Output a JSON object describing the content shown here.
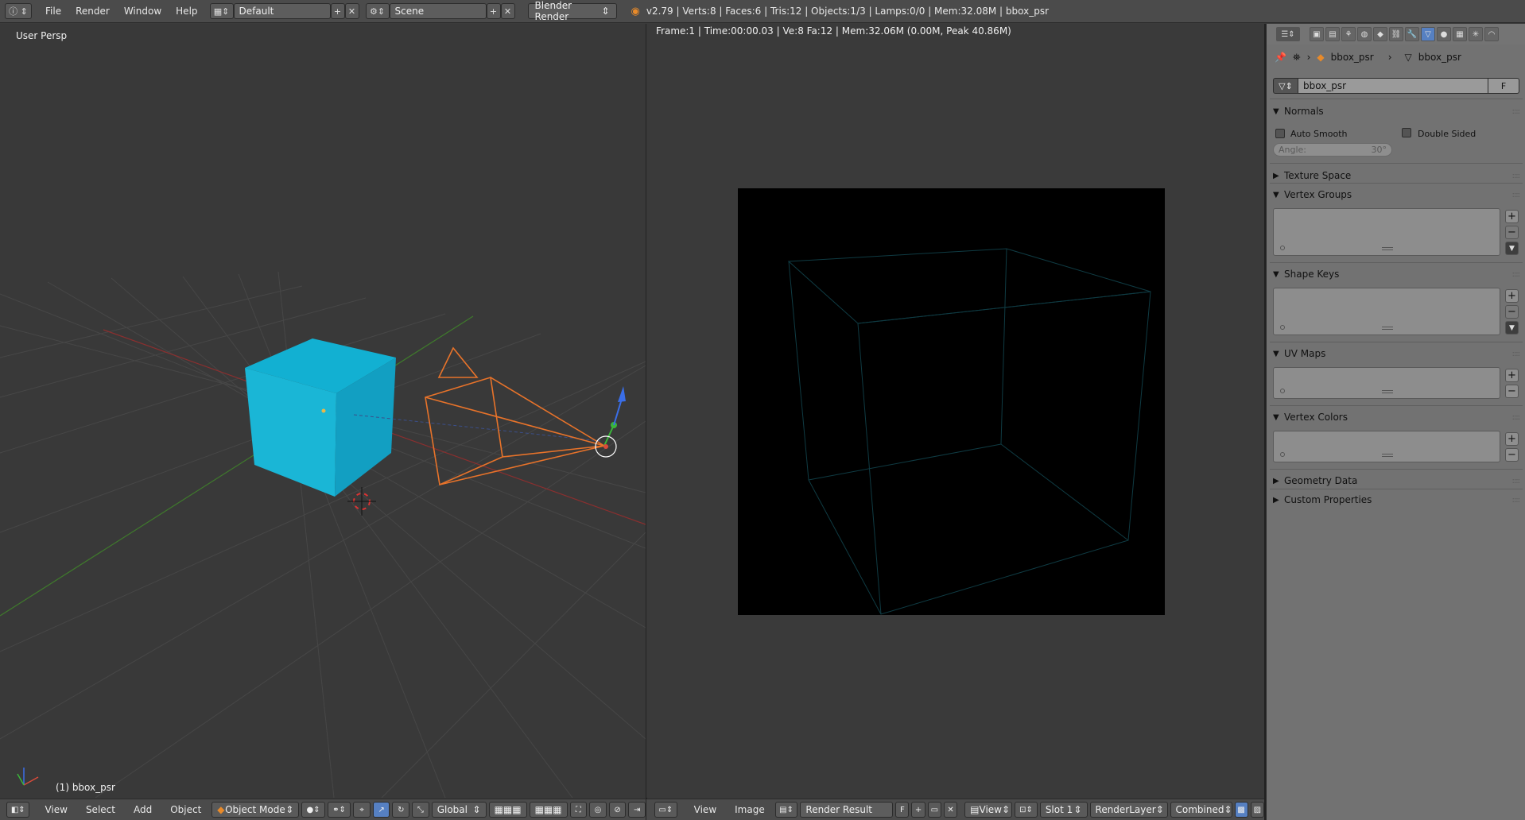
{
  "topbar": {
    "menus": [
      "File",
      "Render",
      "Window",
      "Help"
    ],
    "layout": "Default",
    "scene": "Scene",
    "engine": "Blender Render",
    "stats": "v2.79 | Verts:8 | Faces:6 | Tris:12 | Objects:1/3 | Lamps:0/0 | Mem:32.08M | bbox_psr"
  },
  "viewport": {
    "view_name": "User Persp",
    "object_label": "(1) bbox_psr",
    "header": {
      "menus": [
        "View",
        "Select",
        "Add",
        "Object"
      ],
      "mode": "Object Mode",
      "orientation": "Global"
    },
    "colors": {
      "cube": "#1ab6d6",
      "camera": "#e8732a"
    }
  },
  "image_editor": {
    "frame_info": "Frame:1 | Time:00:00.03 | Ve:8 Fa:12 | Mem:32.06M (0.00M, Peak 40.86M)",
    "header": {
      "menus": [
        "View",
        "Image"
      ],
      "image": "Render Result",
      "fake_user": "F",
      "view_menu": "View",
      "slot": "Slot 1",
      "layer": "RenderLayer",
      "pass": "Combined"
    },
    "wire_color": "#0f3b43"
  },
  "properties": {
    "breadcrumb": [
      "bbox_psr",
      "bbox_psr"
    ],
    "datablock_name": "bbox_psr",
    "datablock_f": "F",
    "panels": {
      "normals": "Normals",
      "auto_smooth": "Auto Smooth",
      "double_sided": "Double Sided",
      "angle_label": "Angle:",
      "angle_value": "30°",
      "texture_space": "Texture Space",
      "vertex_groups": "Vertex Groups",
      "shape_keys": "Shape Keys",
      "uv_maps": "UV Maps",
      "vertex_colors": "Vertex Colors",
      "geometry_data": "Geometry Data",
      "custom_properties": "Custom Properties"
    }
  }
}
